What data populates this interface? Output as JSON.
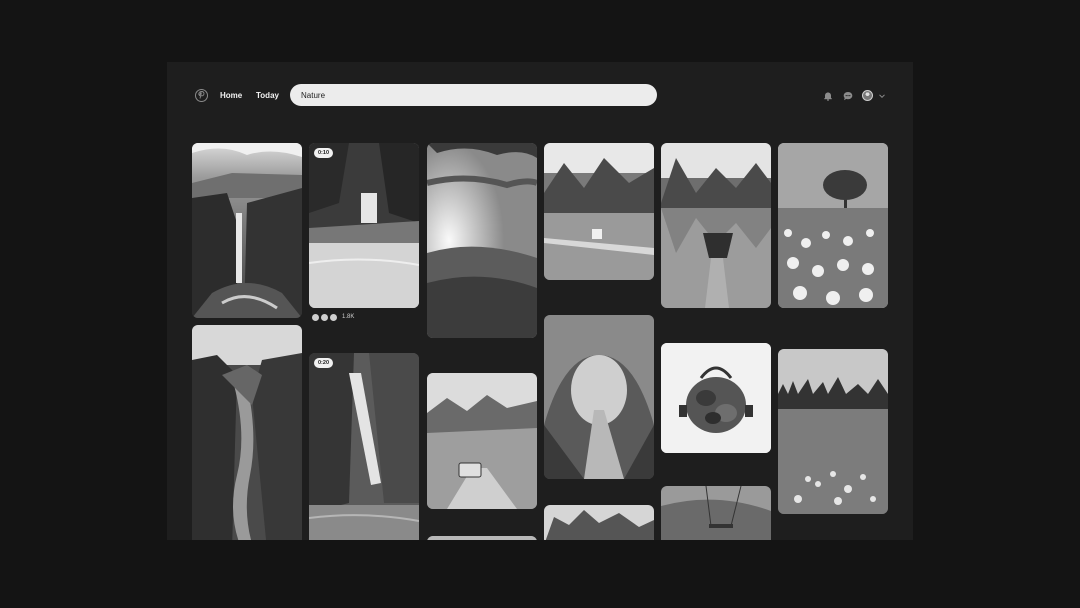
{
  "header": {
    "logo_icon": "pinterest-logo-icon",
    "nav": {
      "home": "Home",
      "today": "Today"
    },
    "search_value": "Nature",
    "icons": [
      "bell-icon",
      "chat-bubble-icon",
      "avatar",
      "chevron-down-icon"
    ]
  },
  "pins": {
    "video_duration_1": "0:10",
    "video_duration_2": "0:20",
    "reaction_count": "1.8K",
    "subjects": [
      "waterfall-canyon",
      "jungle-waterfall-pool",
      "sunset-hills",
      "mountain-lake-dock",
      "alpine-lake-boat",
      "tree-flower-field",
      "river-canyon",
      "tall-waterfall-cliff",
      "van-mountain-road",
      "tree-tunnel-path",
      "camo-handbag",
      "meadow-forest",
      "rocky-peaks",
      "swing-valley",
      "strip-pin"
    ]
  }
}
